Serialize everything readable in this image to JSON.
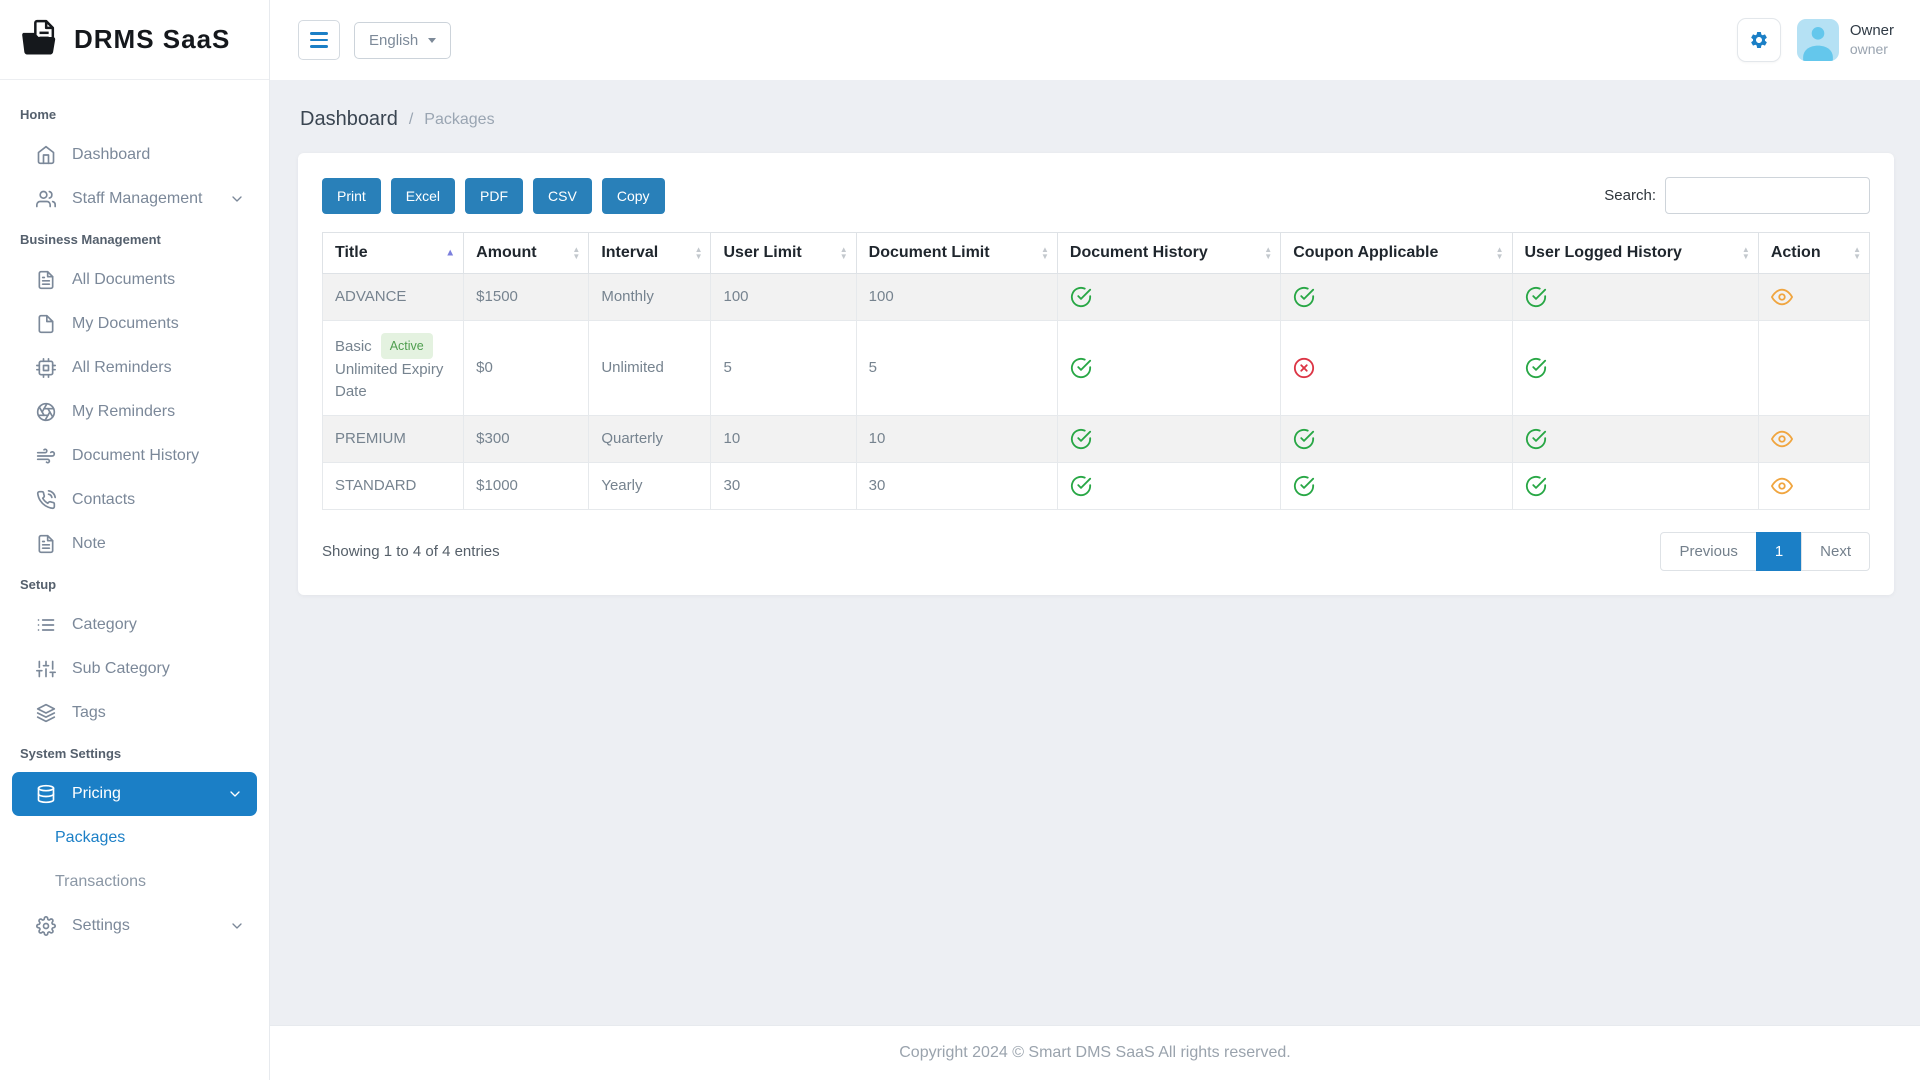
{
  "brand": {
    "name": "DRMS SaaS"
  },
  "header": {
    "language_selected": "English",
    "user": {
      "name": "Owner",
      "role": "owner"
    }
  },
  "breadcrumb": {
    "section": "Dashboard",
    "separator": "/",
    "page": "Packages"
  },
  "sidebar": {
    "sections": [
      {
        "label": "Home",
        "items": [
          {
            "label": "Dashboard"
          },
          {
            "label": "Staff Management"
          }
        ]
      },
      {
        "label": "Business Management",
        "items": [
          {
            "label": "All Documents"
          },
          {
            "label": "My Documents"
          },
          {
            "label": "All Reminders"
          },
          {
            "label": "My Reminders"
          },
          {
            "label": "Document History"
          },
          {
            "label": "Contacts"
          },
          {
            "label": "Note"
          }
        ]
      },
      {
        "label": "Setup",
        "items": [
          {
            "label": "Category"
          },
          {
            "label": "Sub Category"
          },
          {
            "label": "Tags"
          }
        ]
      },
      {
        "label": "System Settings",
        "items": [
          {
            "label": "Pricing",
            "children": [
              {
                "label": "Packages"
              },
              {
                "label": "Transactions"
              }
            ]
          },
          {
            "label": "Settings"
          }
        ]
      }
    ]
  },
  "table": {
    "export_buttons": [
      "Print",
      "Excel",
      "PDF",
      "CSV",
      "Copy"
    ],
    "search_label": "Search:",
    "search_value": "",
    "columns": [
      "Title",
      "Amount",
      "Interval",
      "User Limit",
      "Document Limit",
      "Document History",
      "Coupon Applicable",
      "User Logged History",
      "Action"
    ],
    "rows": [
      {
        "title": "ADVANCE",
        "amount": "$1500",
        "interval": "Monthly",
        "user_limit": "100",
        "document_limit": "100",
        "document_history": "yes",
        "coupon_applicable": "yes",
        "user_logged_history": "yes",
        "action": "view"
      },
      {
        "title": "Basic",
        "badge": "Active",
        "subtitle": "Unlimited Expiry Date",
        "amount": "$0",
        "interval": "Unlimited",
        "user_limit": "5",
        "document_limit": "5",
        "document_history": "yes",
        "coupon_applicable": "no",
        "user_logged_history": "yes",
        "action": ""
      },
      {
        "title": "PREMIUM",
        "amount": "$300",
        "interval": "Quarterly",
        "user_limit": "10",
        "document_limit": "10",
        "document_history": "yes",
        "coupon_applicable": "yes",
        "user_logged_history": "yes",
        "action": "view"
      },
      {
        "title": "STANDARD",
        "amount": "$1000",
        "interval": "Yearly",
        "user_limit": "30",
        "document_limit": "30",
        "document_history": "yes",
        "coupon_applicable": "yes",
        "user_logged_history": "yes",
        "action": "view"
      }
    ],
    "info": "Showing 1 to 4 of 4 entries",
    "pagination": {
      "previous": "Previous",
      "current": "1",
      "next": "Next"
    }
  },
  "footer": {
    "copyright": "Copyright 2024 © Smart DMS SaaS All rights reserved."
  },
  "colors": {
    "accent": "#1b7fc6",
    "export_button": "#2980b9",
    "success": "#28a745",
    "danger": "#dc3545",
    "warning": "#f0a53f",
    "active_badge_bg": "#e4f2e0",
    "active_badge_text": "#4f9e4f",
    "content_bg": "#edeff3"
  }
}
